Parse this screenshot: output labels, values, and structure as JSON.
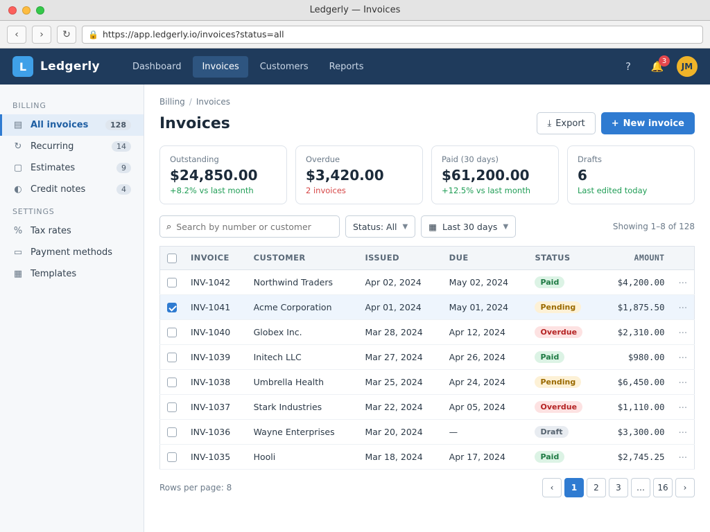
{
  "window": {
    "title": "Ledgerly — Invoices"
  },
  "browser": {
    "url": "https://app.ledgerly.io/invoices?status=all"
  },
  "header": {
    "logo_letter": "L",
    "app_name": "Ledgerly",
    "nav": [
      {
        "label": "Dashboard"
      },
      {
        "label": "Invoices"
      },
      {
        "label": "Customers"
      },
      {
        "label": "Reports"
      }
    ],
    "notifications_count": "3",
    "avatar_initials": "JM"
  },
  "sidebar": {
    "section_main": "Billing",
    "items": [
      {
        "label": "All invoices",
        "count": "128"
      },
      {
        "label": "Recurring",
        "count": "14"
      },
      {
        "label": "Estimates",
        "count": "9"
      },
      {
        "label": "Credit notes",
        "count": "4"
      }
    ],
    "section_settings": "Settings",
    "settings_items": [
      {
        "label": "Tax rates"
      },
      {
        "label": "Payment methods"
      },
      {
        "label": "Templates"
      }
    ]
  },
  "main": {
    "breadcrumb": [
      "Billing",
      "Invoices"
    ],
    "title": "Invoices",
    "export_label": "Export",
    "new_label": "New invoice",
    "cards": [
      {
        "label": "Outstanding",
        "value": "$24,850.00",
        "delta": "+8.2% vs last month",
        "trend": "up"
      },
      {
        "label": "Overdue",
        "value": "$3,420.00",
        "delta": "2 invoices",
        "trend": "down"
      },
      {
        "label": "Paid (30 days)",
        "value": "$61,200.00",
        "delta": "+12.5% vs last month",
        "trend": "up"
      },
      {
        "label": "Drafts",
        "value": "6",
        "delta": "Last edited today",
        "trend": "up"
      }
    ],
    "search_placeholder": "Search by number or customer",
    "status_filter": "Status: All",
    "date_filter": "Last 30 days",
    "result_count": "Showing 1–8 of 128",
    "columns": [
      "",
      "Invoice",
      "Customer",
      "Issued",
      "Due",
      "Status",
      "Amount",
      ""
    ],
    "rows": [
      {
        "number": "INV-1042",
        "customer": "Northwind Traders",
        "issued": "Apr 02, 2024",
        "due": "May 02, 2024",
        "status": "Paid",
        "status_class": "paid",
        "amount": "$4,200.00"
      },
      {
        "number": "INV-1041",
        "customer": "Acme Corporation",
        "issued": "Apr 01, 2024",
        "due": "May 01, 2024",
        "status": "Pending",
        "status_class": "pending",
        "amount": "$1,875.50"
      },
      {
        "number": "INV-1040",
        "customer": "Globex Inc.",
        "issued": "Mar 28, 2024",
        "due": "Apr 12, 2024",
        "status": "Overdue",
        "status_class": "overdue",
        "amount": "$2,310.00"
      },
      {
        "number": "INV-1039",
        "customer": "Initech LLC",
        "issued": "Mar 27, 2024",
        "due": "Apr 26, 2024",
        "status": "Paid",
        "status_class": "paid",
        "amount": "$980.00"
      },
      {
        "number": "INV-1038",
        "customer": "Umbrella Health",
        "issued": "Mar 25, 2024",
        "due": "Apr 24, 2024",
        "status": "Pending",
        "status_class": "pending",
        "amount": "$6,450.00"
      },
      {
        "number": "INV-1037",
        "customer": "Stark Industries",
        "issued": "Mar 22, 2024",
        "due": "Apr 05, 2024",
        "status": "Overdue",
        "status_class": "overdue",
        "amount": "$1,110.00"
      },
      {
        "number": "INV-1036",
        "customer": "Wayne Enterprises",
        "issued": "Mar 20, 2024",
        "due": "—",
        "status": "Draft",
        "status_class": "draft",
        "amount": "$3,300.00"
      },
      {
        "number": "INV-1035",
        "customer": "Hooli",
        "issued": "Mar 18, 2024",
        "due": "Apr 17, 2024",
        "status": "Paid",
        "status_class": "paid",
        "amount": "$2,745.25"
      }
    ],
    "pager_label": "Rows per page: 8",
    "pages": [
      "‹",
      "1",
      "2",
      "3",
      "…",
      "16",
      "›"
    ]
  }
}
